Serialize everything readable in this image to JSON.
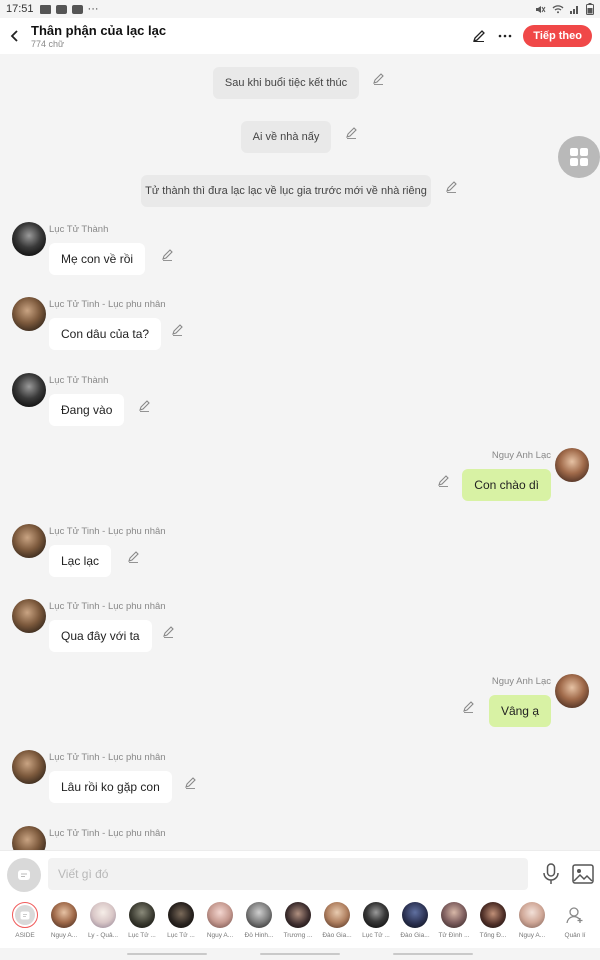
{
  "status_bar": {
    "time": "17:51",
    "more": "···"
  },
  "header": {
    "title": "Thân phận của lạc lạc",
    "word_count": "774 chữ",
    "next_label": "Tiếp theo"
  },
  "colors": {
    "accent": "#f04848",
    "my_bubble": "#d8f2a4",
    "narration_bg": "#e9e9e9"
  },
  "messages": [
    {
      "kind": "narration",
      "text": "Sau khi buổi tiệc kết thúc"
    },
    {
      "kind": "narration",
      "text": "Ai về nhà nấy"
    },
    {
      "kind": "narration",
      "text": "Tử thành thì đưa lạc lạc về lục gia trước mới về nhà riêng"
    },
    {
      "kind": "left",
      "name": "Lục Tử Thành",
      "text": "Mẹ con về rồi"
    },
    {
      "kind": "left",
      "name": "Lục Tử Tinh - Lục phu nhân",
      "text": "Con dâu của ta?"
    },
    {
      "kind": "left",
      "name": "Lục Tử Thành",
      "text": "Đang vào"
    },
    {
      "kind": "right",
      "name": "Nguy Anh Lạc",
      "text": "Con chào dì"
    },
    {
      "kind": "left",
      "name": "Lục Tử Tinh - Lục phu nhân",
      "text": "Lạc lạc"
    },
    {
      "kind": "left",
      "name": "Lục Tử Tinh - Lục phu nhân",
      "text": "Qua đây với ta"
    },
    {
      "kind": "right",
      "name": "Nguy Anh Lạc",
      "text": "Vâng ạ"
    },
    {
      "kind": "left",
      "name": "Lục Tử Tinh - Lục phu nhân",
      "text": "Lâu rồi ko gặp con"
    },
    {
      "kind": "left",
      "name": "Lục Tử Tinh - Lục phu nhân",
      "text": ""
    }
  ],
  "composer": {
    "placeholder": "Viết gì đó"
  },
  "characters": [
    {
      "label": "ASIDE",
      "avatar": "aside"
    },
    {
      "label": "Nguy A...",
      "avatar": "warm"
    },
    {
      "label": "Ly - Quả...",
      "avatar": "anime"
    },
    {
      "label": "Lục Tử ...",
      "avatar": "dark"
    },
    {
      "label": "Lục Tử ...",
      "avatar": "dark2"
    },
    {
      "label": "Nguy A...",
      "avatar": "pink"
    },
    {
      "label": "Đỗ Hinh...",
      "avatar": "mono"
    },
    {
      "label": "Trương ...",
      "avatar": "dark3"
    },
    {
      "label": "Đào Gia...",
      "avatar": "warm2"
    },
    {
      "label": "Lục Tử ...",
      "avatar": "bw"
    },
    {
      "label": "Đào Gia...",
      "avatar": "blue"
    },
    {
      "label": "Tử Đình ...",
      "avatar": "warm3"
    },
    {
      "label": "Tổng Đ...",
      "avatar": "dark4"
    },
    {
      "label": "Nguy A...",
      "avatar": "light"
    },
    {
      "label": "Quản lí",
      "avatar": "manage"
    }
  ]
}
